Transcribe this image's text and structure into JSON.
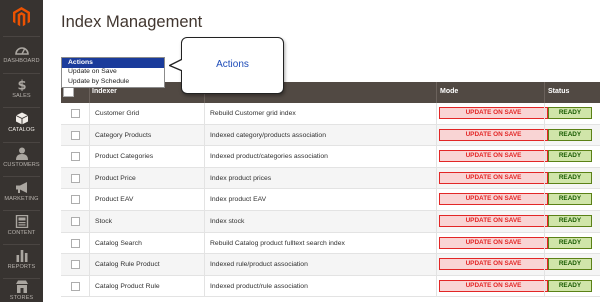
{
  "sidebar": {
    "items": [
      {
        "label": "DASHBOARD",
        "icon": "dashboard-icon"
      },
      {
        "label": "SALES",
        "icon": "dollar-icon"
      },
      {
        "label": "CATALOG",
        "icon": "cube-icon"
      },
      {
        "label": "CUSTOMERS",
        "icon": "person-icon"
      },
      {
        "label": "MARKETING",
        "icon": "megaphone-icon"
      },
      {
        "label": "CONTENT",
        "icon": "content-icon"
      },
      {
        "label": "REPORTS",
        "icon": "bar-chart-icon"
      },
      {
        "label": "STORES",
        "icon": "store-icon"
      }
    ]
  },
  "page": {
    "title": "Index Management"
  },
  "actions": {
    "selected": "Actions",
    "options": [
      "Update on Save",
      "Update by Schedule"
    ]
  },
  "callout": {
    "text": "Actions"
  },
  "table": {
    "columns": {
      "indexer": "Indexer",
      "description": "",
      "mode": "Mode",
      "status": "Status"
    },
    "rows": [
      {
        "indexer": "Customer Grid",
        "description": "Rebuild Customer grid index",
        "mode": "UPDATE ON SAVE",
        "status": "READY"
      },
      {
        "indexer": "Category Products",
        "description": "Indexed category/products association",
        "mode": "UPDATE ON SAVE",
        "status": "READY"
      },
      {
        "indexer": "Product Categories",
        "description": "Indexed product/categories association",
        "mode": "UPDATE ON SAVE",
        "status": "READY"
      },
      {
        "indexer": "Product Price",
        "description": "Index product prices",
        "mode": "UPDATE ON SAVE",
        "status": "READY"
      },
      {
        "indexer": "Product EAV",
        "description": "Index product EAV",
        "mode": "UPDATE ON SAVE",
        "status": "READY"
      },
      {
        "indexer": "Stock",
        "description": "Index stock",
        "mode": "UPDATE ON SAVE",
        "status": "READY"
      },
      {
        "indexer": "Catalog Search",
        "description": "Rebuild Catalog product fulltext search index",
        "mode": "UPDATE ON SAVE",
        "status": "READY"
      },
      {
        "indexer": "Catalog Rule Product",
        "description": "Indexed rule/product association",
        "mode": "UPDATE ON SAVE",
        "status": "READY"
      },
      {
        "indexer": "Catalog Product Rule",
        "description": "Indexed product/rule association",
        "mode": "UPDATE ON SAVE",
        "status": "READY"
      }
    ]
  },
  "colors": {
    "sidebar_bg": "#373330",
    "header_bg": "#514943",
    "logo": "#eb5202",
    "mode_badge_border": "#e22626",
    "status_badge_bg": "#d0e5a9",
    "dropdown_selected_bg": "#1a3b9b",
    "callout_text": "#1d4bb8"
  }
}
